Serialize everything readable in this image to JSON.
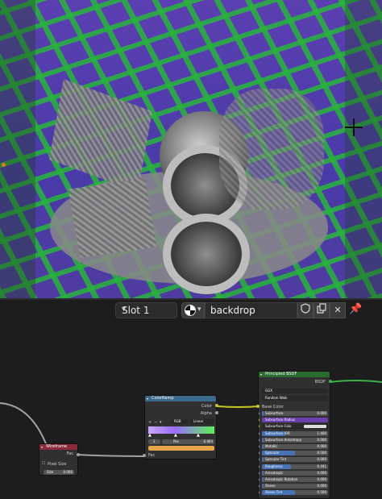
{
  "header": {
    "slot_label": "Slot 1",
    "material_name": "backdrop"
  },
  "nodes": {
    "wireframe": {
      "title": "Wireframe",
      "output": "Fac",
      "checkbox_label": "Pixel Size",
      "size_label": "Size",
      "size_value": "0.000"
    },
    "colorramp": {
      "title": "ColorRamp",
      "out_color": "Color",
      "out_alpha": "Alpha",
      "mode": "RGB",
      "interpolation": "Linear",
      "index": "1",
      "pos_label": "Pos",
      "pos_value": "0.464",
      "input": "Fac"
    },
    "bsdf": {
      "title": "Principled BSDF",
      "output": "BSDF",
      "distribution": "GGX",
      "subsurface_method": "Random Walk",
      "base_color": "Base Color",
      "subsurface_radius": "Subsurface Radius",
      "subsurface_color": "Subsurface Colo",
      "props": [
        {
          "label": "Subsurface",
          "value": "0.000",
          "fill": 0.0
        },
        {
          "label": "Subsurface IOR",
          "value": "1.400",
          "fill": 0.35
        },
        {
          "label": "Subsurface Anisotropy",
          "value": "0.000",
          "fill": 0.0
        },
        {
          "label": "Metallic",
          "value": "0.000",
          "fill": 0.0
        },
        {
          "label": "Specular",
          "value": "0.500",
          "fill": 0.5
        },
        {
          "label": "Specular Tint",
          "value": "0.000",
          "fill": 0.0
        },
        {
          "label": "Roughness",
          "value": "0.441",
          "fill": 0.44
        },
        {
          "label": "Anisotropic",
          "value": "0.000",
          "fill": 0.0
        },
        {
          "label": "Anisotropic Rotation",
          "value": "0.000",
          "fill": 0.0
        },
        {
          "label": "Sheen",
          "value": "0.000",
          "fill": 0.0
        },
        {
          "label": "Sheen Tint",
          "value": "0.500",
          "fill": 0.5
        }
      ]
    }
  },
  "colors": {
    "wire_green": "#3db04a",
    "wire_yellow": "#c7c729",
    "wire_gray": "#a1a1a1",
    "bsdf_header": "#2a6b2f",
    "ramp_header": "#3b6a8a",
    "wireframe_header": "#8a2a3a"
  }
}
